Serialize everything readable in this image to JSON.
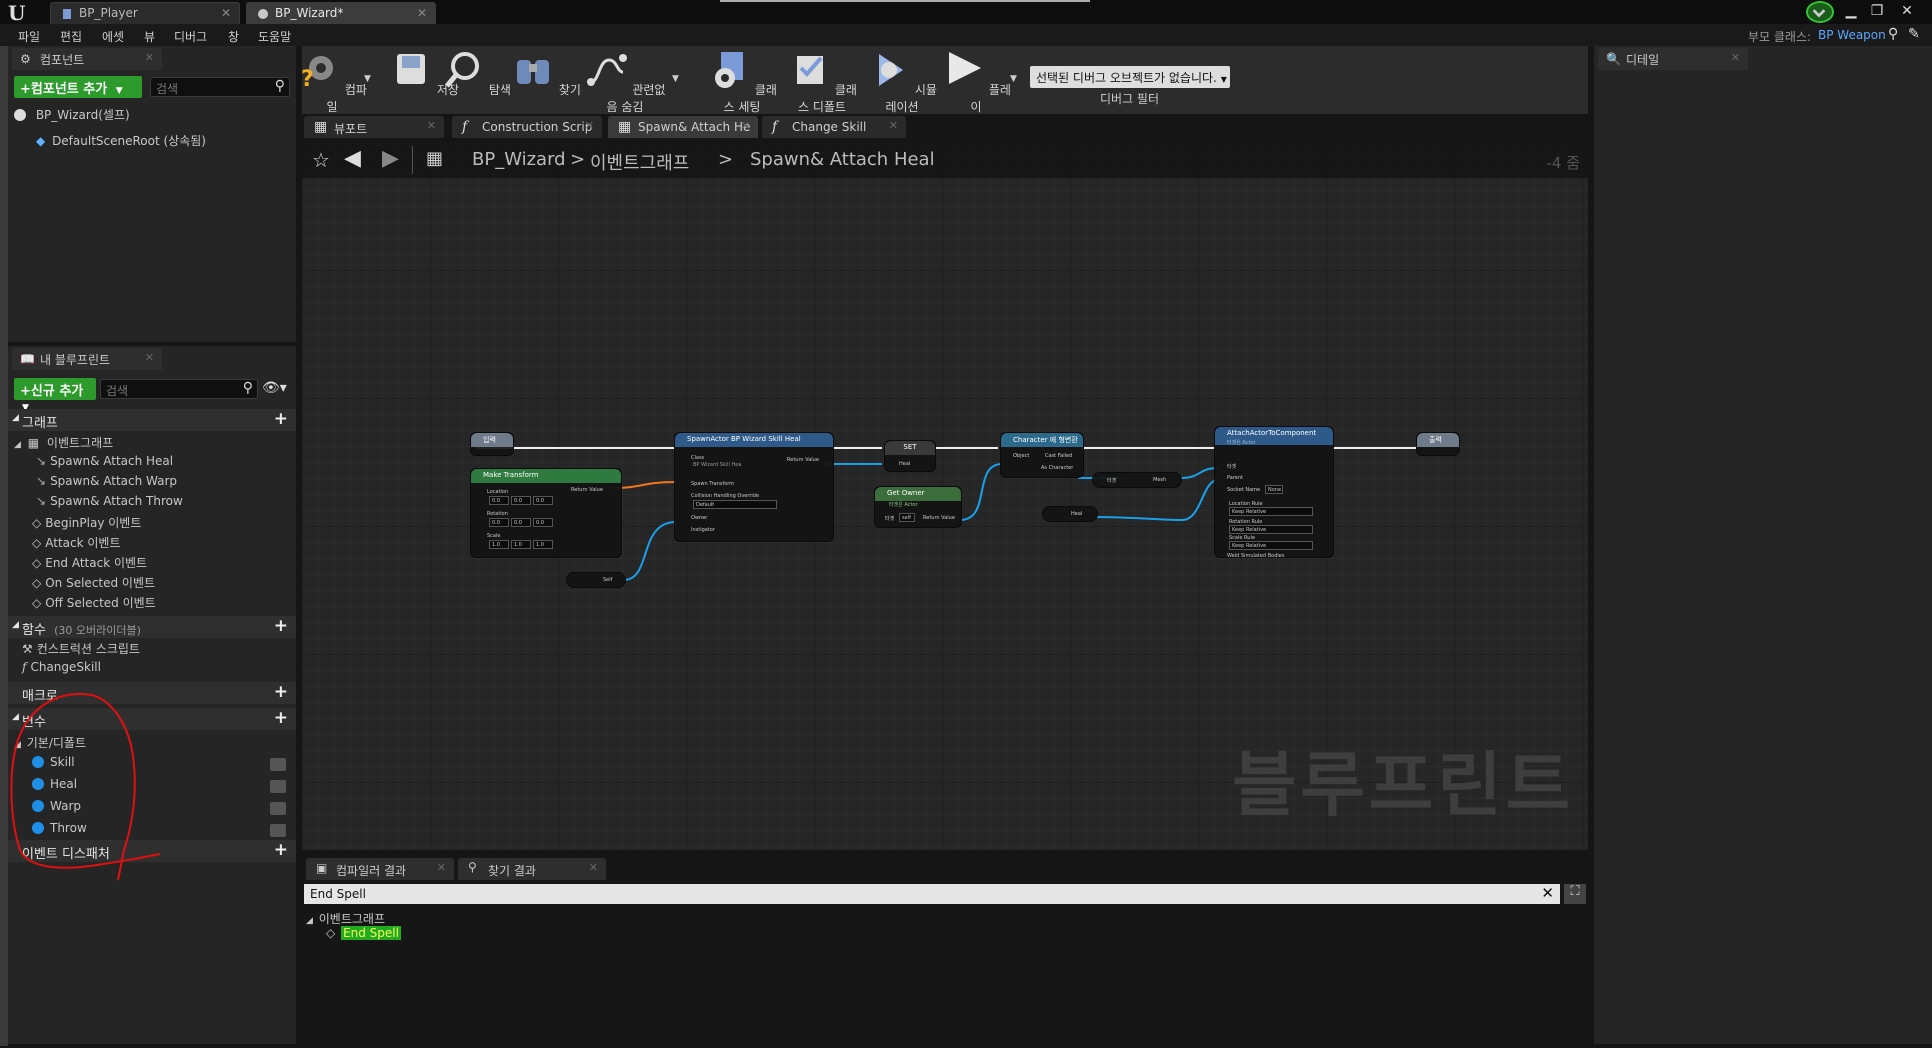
{
  "titlebar": {
    "tabs": [
      {
        "label": "BP_Player",
        "icon": "blueprint-icon"
      },
      {
        "label": "BP_Wizard*",
        "icon": "blueprint-instance-icon"
      }
    ],
    "parent_class_label": "부모 클래스:",
    "parent_class_value": "BP Weapon"
  },
  "menu": [
    "파일",
    "편집",
    "에셋",
    "뷰",
    "디버그",
    "창",
    "도움말"
  ],
  "components": {
    "tab_label": "컴포넌트",
    "add_button": "+컴포넌트 추가",
    "search_placeholder": "검색",
    "root": "BP_Wizard(셀프)",
    "default_scene_root": "DefaultSceneRoot (상속됨)"
  },
  "my_blueprint": {
    "tab_label": "내 블루프린트",
    "add_new_button": "+신규 추가",
    "search_placeholder": "검색",
    "graph_section": "그래프",
    "event_graph": "이벤트그래프",
    "events": [
      "Spawn& Attach Heal",
      "Spawn& Attach Warp",
      "Spawn& Attach Throw",
      "BeginPlay 이벤트",
      "Attack 이벤트",
      "End Attack 이벤트",
      "On Selected 이벤트",
      "Off Selected 이벤트"
    ],
    "functions_section": "함수",
    "functions_overridable": "(30 오버라이더블)",
    "functions": [
      "컨스트럭션 스크립트",
      "ChangeSkill"
    ],
    "macros_section": "매크로",
    "variables_section": "변수",
    "default_category": "기본/디폴트",
    "variables": [
      "Skill",
      "Heal",
      "Warp",
      "Throw"
    ],
    "event_dispatchers_section": "이벤트 디스패처"
  },
  "toolbar": {
    "compile": "컴파일",
    "save": "저장",
    "browse": "탐색",
    "find": "찾기",
    "hide_unrelated": "관련없음 숨김",
    "class_settings": "클래스 세팅",
    "class_defaults": "클래스 디폴트",
    "simulation": "시뮬레이션",
    "play": "플레이",
    "debug_object": "선택된 디버그 오브젝트가 없습니다.",
    "debug_filter": "디버그 필터"
  },
  "graph_tabs": [
    {
      "label": "뷰포트",
      "icon": "viewport-icon"
    },
    {
      "label": "Construction Scrip",
      "icon": "function-icon"
    },
    {
      "label": "Spawn& Attach He",
      "icon": "event-graph-icon"
    },
    {
      "label": "Change Skill",
      "icon": "function-icon"
    }
  ],
  "breadcrumb": {
    "blueprint": "BP_Wizard",
    "graph": "이벤트그래프",
    "current": "Spawn& Attach Heal",
    "zoom": "-4 줌"
  },
  "nodes": {
    "entry": "입력",
    "make_transform": "Make Transform",
    "make_transform_return": "Return Value",
    "location": "Location",
    "rotation": "Rotation",
    "scale": "Scale",
    "zero": "0.0",
    "one": "1.0",
    "self": "Self",
    "spawn_actor": "SpawnActor BP Wizard Skill Heal",
    "class": "Class",
    "class_value": "BP Wizard Skill Hea",
    "return_value": "Return Value",
    "spawn_transform": "Spawn Transform",
    "collision_override": "Collision Handling Override",
    "collision_value": "Default",
    "owner": "Owner",
    "instigator": "Instigator",
    "set": "SET",
    "heal": "Heal",
    "get_owner": "Get Owner",
    "get_owner_sub": "타겟은 Actor",
    "target": "타겟",
    "self_short": "self",
    "cast": "Character 에 형변환",
    "object": "Object",
    "cast_failed": "Cast Failed",
    "as_character": "As Character",
    "mesh": "Mesh",
    "attach": "AttachActorToComponent",
    "attach_sub": "타겟은 Actor",
    "parent": "Parent",
    "socket_name": "Socket Name",
    "socket_value": "None",
    "location_rule": "Location Rule",
    "rotation_rule": "Rotation Rule",
    "scale_rule": "Scale Rule",
    "keep_relative": "Keep Relative",
    "weld": "Weld Simulated Bodies",
    "exit": "출력"
  },
  "watermark": "블루프린트",
  "bottom": {
    "compiler_results": "컴파일러 결과",
    "find_results": "찾기 결과",
    "search_value": "End Spell",
    "result_group": "이벤트그래프",
    "result_item": "End Spell"
  },
  "details": {
    "tab_label": "디테일"
  },
  "colors": {
    "accent_green": "#2c9b2c",
    "variable_blue": "#1e8fe6",
    "annotation_red": "#e01010"
  }
}
